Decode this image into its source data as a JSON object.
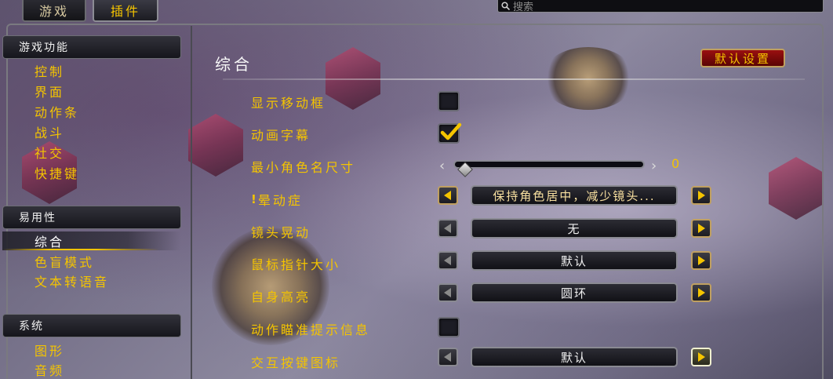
{
  "tabs": [
    {
      "label": "游戏"
    },
    {
      "label": "插件"
    }
  ],
  "search": {
    "placeholder": "搜索"
  },
  "sidebar": {
    "categories": [
      {
        "title": "游戏功能",
        "items": [
          "控制",
          "界面",
          "动作条",
          "战斗",
          "社交",
          "快捷键"
        ]
      },
      {
        "title": "易用性",
        "items": [
          "综合",
          "色盲模式",
          "文本转语音"
        ]
      },
      {
        "title": "系统",
        "items": [
          "图形",
          "音频"
        ]
      }
    ],
    "selected": "综合"
  },
  "content": {
    "title": "综合",
    "defaults_label": "默认设置",
    "options": {
      "show_move_pad": {
        "label": "显示移动框",
        "checked": false
      },
      "cinematic_subtitles": {
        "label": "动画字幕",
        "checked": true
      },
      "min_char_name_size": {
        "label": "最小角色名尺寸",
        "value": "0"
      },
      "motion_sickness": {
        "label": "晕动症",
        "value": "保持角色居中，减少镜头..."
      },
      "camera_shake": {
        "label": "镜头晃动",
        "value": "无"
      },
      "cursor_size": {
        "label": "鼠标指针大小",
        "value": "默认"
      },
      "self_highlight": {
        "label": "自身高亮",
        "value": "圆环"
      },
      "action_targeting_tooltip": {
        "label": "动作瞄准提示信息",
        "checked": false
      },
      "interact_key_icons": {
        "label": "交互按键图标",
        "value": "默认"
      }
    }
  },
  "colors": {
    "accent": "#f4c400",
    "defaults_button": "#8a0a0a"
  }
}
